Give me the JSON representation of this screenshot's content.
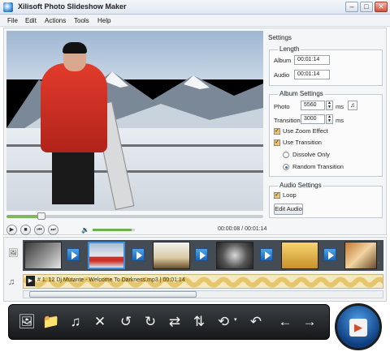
{
  "window": {
    "title": "Xilisoft Photo Slideshow Maker",
    "min_glyph": "–",
    "max_glyph": "□",
    "close_glyph": "✕"
  },
  "menu": {
    "items": [
      "File",
      "Edit",
      "Actions",
      "Tools",
      "Help"
    ]
  },
  "player": {
    "time_display": "00:00:08 / 00:01:14",
    "volume_glyph": "🔈",
    "play_glyph": "▶",
    "stop_glyph": "■",
    "prev_glyph": "⏮",
    "next_glyph": "⏭"
  },
  "settings": {
    "title": "Settings",
    "length": {
      "label": "Length",
      "album_label": "Album",
      "album_value": "00:01:14",
      "audio_label": "Audio",
      "audio_value": "00:01:14"
    },
    "album_settings": {
      "label": "Album Settings",
      "photo_label": "Photo",
      "photo_value": "5560",
      "photo_unit": "ms",
      "transition_label": "Transition",
      "transition_value": "3000",
      "transition_unit": "ms",
      "zoom_label": "Use Zoom Effect",
      "use_transition_label": "Use Transition",
      "dissolve_label": "Dissolve Only",
      "random_label": "Random Transition"
    },
    "audio_settings": {
      "label": "Audio Settings",
      "loop_label": "Loop",
      "edit_audio_label": "Edit Audio"
    }
  },
  "timeline": {
    "audio_clip": "# 1. 12 Dj Mutante - Welcome To Darkness.mp3 | 00:01:14",
    "audio_play_glyph": "▶",
    "image_track_glyph": "🖼",
    "music_track_glyph": "♫"
  },
  "toolbar": {
    "add_photo": "🖼",
    "add_folder": "📁",
    "add_music": "♫",
    "delete": "✕",
    "rotate_left": "↺",
    "rotate_right": "↻",
    "swap": "⇄",
    "flip": "⇅",
    "transition": "⟲",
    "undo": "↶",
    "move_left": "←",
    "move_right": "→",
    "start": "▶"
  }
}
